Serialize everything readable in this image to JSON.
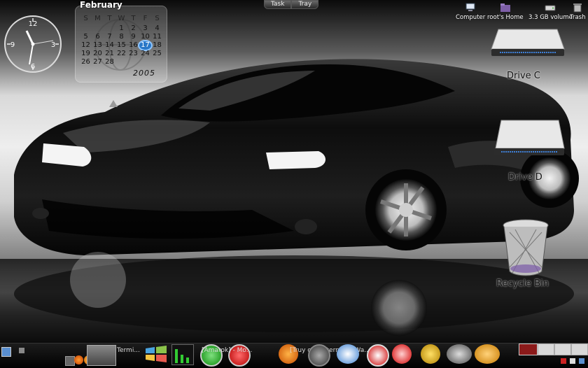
{
  "calendar": {
    "month": "February",
    "weekdays": [
      "S",
      "M",
      "T",
      "W",
      "T",
      "F",
      "S"
    ],
    "weeks": [
      [
        "",
        "",
        "",
        "1",
        "2",
        "3",
        "4"
      ],
      [
        "5",
        "6",
        "7",
        "8",
        "9",
        "10",
        "11"
      ],
      [
        "12",
        "13",
        "14",
        "15",
        "16",
        "17",
        "18"
      ],
      [
        "19",
        "20",
        "21",
        "22",
        "23",
        "24",
        "25"
      ],
      [
        "26",
        "27",
        "28",
        "",
        "",
        "",
        ""
      ]
    ],
    "today": "17",
    "year": "2005"
  },
  "clock": {
    "numerals": [
      "12",
      "3",
      "6",
      "9"
    ]
  },
  "tabs": {
    "task": "Task",
    "tray": "Tray"
  },
  "desktop_top": {
    "computer": "Computer",
    "home": "root's Home",
    "volume": "3.3 GB volume",
    "trash": "Trash"
  },
  "drives": {
    "c_label": "Drive C",
    "d_label": "Drive D",
    "recycle_label": "Recycle Bin"
  },
  "taskbar": {
    "term_label": "Termi...",
    "music_label": "[Amarok] - Mo...",
    "konqueror_label": "[Truy cập internet] - Wa..."
  },
  "colors": {
    "accent": "#2a78c8",
    "taskbar": "#000000",
    "mem_used": "#8b1a1a"
  }
}
